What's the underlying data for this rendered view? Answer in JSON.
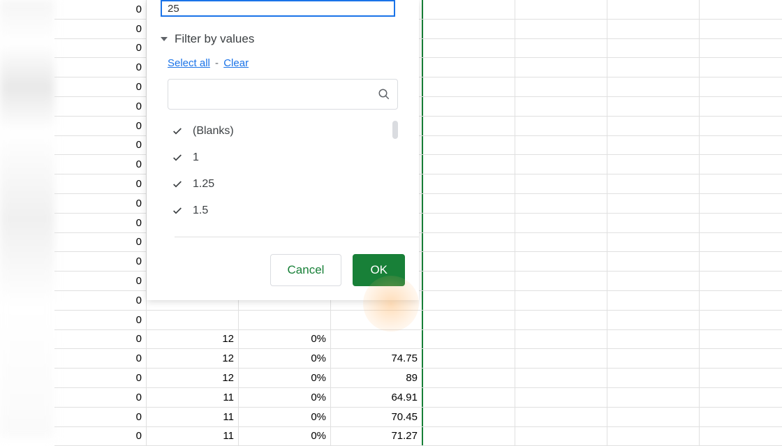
{
  "filter": {
    "condition_value": "25",
    "section_label": "Filter by values",
    "select_all": "Select all",
    "clear": "Clear",
    "search_placeholder": "",
    "values": [
      {
        "label": "(Blanks)",
        "checked": true
      },
      {
        "label": "1",
        "checked": true
      },
      {
        "label": "1.25",
        "checked": true
      },
      {
        "label": "1.5",
        "checked": true
      }
    ],
    "cancel": "Cancel",
    "ok": "OK"
  },
  "grid": {
    "col_zero_rows": 22,
    "data_rows": [
      {
        "c2": "12",
        "c3": "0%",
        "c4": "74.75"
      },
      {
        "c2": "12",
        "c3": "0%",
        "c4": "89"
      },
      {
        "c2": "11",
        "c3": "0%",
        "c4": "64.91"
      },
      {
        "c2": "11",
        "c3": "0%",
        "c4": "70.45"
      },
      {
        "c2": "11",
        "c3": "0%",
        "c4": "71.27"
      }
    ],
    "peek_row": {
      "c2": "12",
      "c3": "0%",
      "c4": ""
    }
  }
}
